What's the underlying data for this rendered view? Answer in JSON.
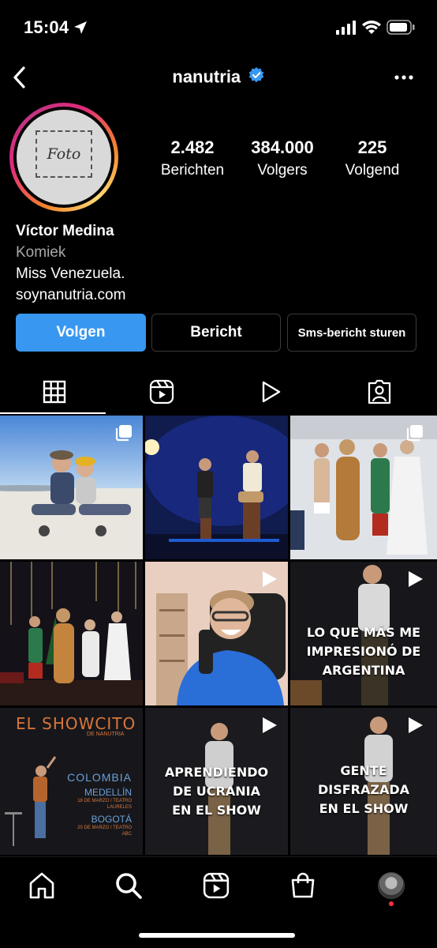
{
  "status_bar": {
    "time": "15:04"
  },
  "header": {
    "username": "nanutria",
    "verified": true
  },
  "profile": {
    "avatar_text": "Foto",
    "stats": [
      {
        "value": "2.482",
        "label": "Berichten"
      },
      {
        "value": "384.000",
        "label": "Volgers"
      },
      {
        "value": "225",
        "label": "Volgend"
      }
    ],
    "name": "Víctor Medina",
    "category": "Komiek",
    "bio": "Miss Venezuela.",
    "link": "soynanutria.com"
  },
  "actions": {
    "follow": "Volgen",
    "message": "Bericht",
    "sms": "Sms-bericht sturen"
  },
  "tabs": [
    {
      "icon": "grid-icon",
      "active": true
    },
    {
      "icon": "reels-icon",
      "active": false
    },
    {
      "icon": "play-icon",
      "active": false
    },
    {
      "icon": "tagged-icon",
      "active": false
    }
  ],
  "posts": [
    {
      "kind": "carousel",
      "text": ""
    },
    {
      "kind": "photo",
      "text": ""
    },
    {
      "kind": "carousel",
      "text": ""
    },
    {
      "kind": "photo",
      "text": ""
    },
    {
      "kind": "reel",
      "text": ""
    },
    {
      "kind": "reel",
      "text": "LO QUE MÁS ME IMPRESIONÓ DE ARGENTINA"
    },
    {
      "kind": "poster",
      "title": "EL SHOWCITO",
      "subtitle": "DE NANUTRIA",
      "country": "COLOMBIA",
      "city1": "MEDELLÍN",
      "date1": "18 DE MARZO / TEATRO LAURELES",
      "city2": "BOGOTÁ",
      "date2": "20 DE MARZO / TEATRO ABC"
    },
    {
      "kind": "reel",
      "text": "APRENDIENDO DE UCRANIA EN EL SHOW"
    },
    {
      "kind": "reel",
      "text": "GENTE DISFRAZADA EN EL SHOW"
    }
  ],
  "bottom_nav": [
    "home-icon",
    "search-icon",
    "reels-icon",
    "shop-icon",
    "profile-avatar"
  ],
  "colors": {
    "accent": "#3897f0",
    "background": "#000000",
    "verified": "#3897f0"
  }
}
